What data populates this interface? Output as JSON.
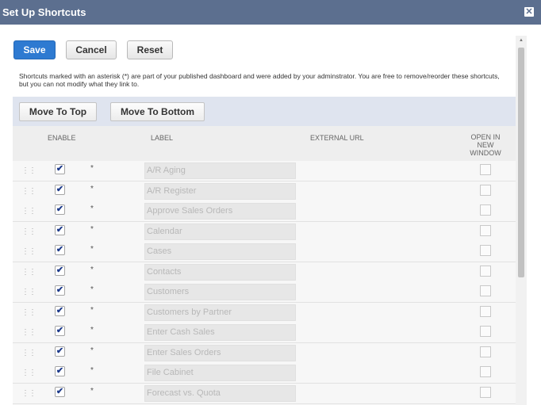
{
  "dialog": {
    "title": "Set Up Shortcuts",
    "close_glyph": "✕"
  },
  "actions": {
    "save": "Save",
    "cancel": "Cancel",
    "reset": "Reset"
  },
  "notice": "Shortcuts marked with an asterisk (*) are part of your published dashboard and were added by your adminstrator. You are free to remove/reorder these shortcuts, but you can not modify what they link to.",
  "toolbar": {
    "move_top": "Move To Top",
    "move_bottom": "Move To Bottom"
  },
  "columns": {
    "enable": "ENABLE",
    "label": "LABEL",
    "url": "EXTERNAL URL",
    "open": "OPEN IN NEW WINDOW"
  },
  "glyphs": {
    "grip": "⋮⋮",
    "check": "✔",
    "asterisk": "*"
  },
  "icons": {
    "close": "close-icon",
    "drag": "drag-handle-icon",
    "check": "checkmark-icon"
  },
  "rows": [
    {
      "label": "A/R Aging",
      "enabled": true,
      "new_window": false
    },
    {
      "label": "A/R Register",
      "enabled": true,
      "new_window": false
    },
    {
      "label": "Approve Sales Orders",
      "enabled": true,
      "new_window": false
    },
    {
      "label": "Calendar",
      "enabled": true,
      "new_window": false
    },
    {
      "label": "Cases",
      "enabled": true,
      "new_window": false
    },
    {
      "label": "Contacts",
      "enabled": true,
      "new_window": false
    },
    {
      "label": "Customers",
      "enabled": true,
      "new_window": false
    },
    {
      "label": "Customers by Partner",
      "enabled": true,
      "new_window": false
    },
    {
      "label": "Enter Cash Sales",
      "enabled": true,
      "new_window": false
    },
    {
      "label": "Enter Sales Orders",
      "enabled": true,
      "new_window": false
    },
    {
      "label": "File Cabinet",
      "enabled": true,
      "new_window": false
    },
    {
      "label": "Forecast vs. Quota",
      "enabled": true,
      "new_window": false
    }
  ],
  "colors": {
    "titlebar": "#5c6f8f",
    "primary_button": "#2e7ad1",
    "toolbar_band": "#dfe4ef",
    "checkmark": "#1d3a8a"
  }
}
